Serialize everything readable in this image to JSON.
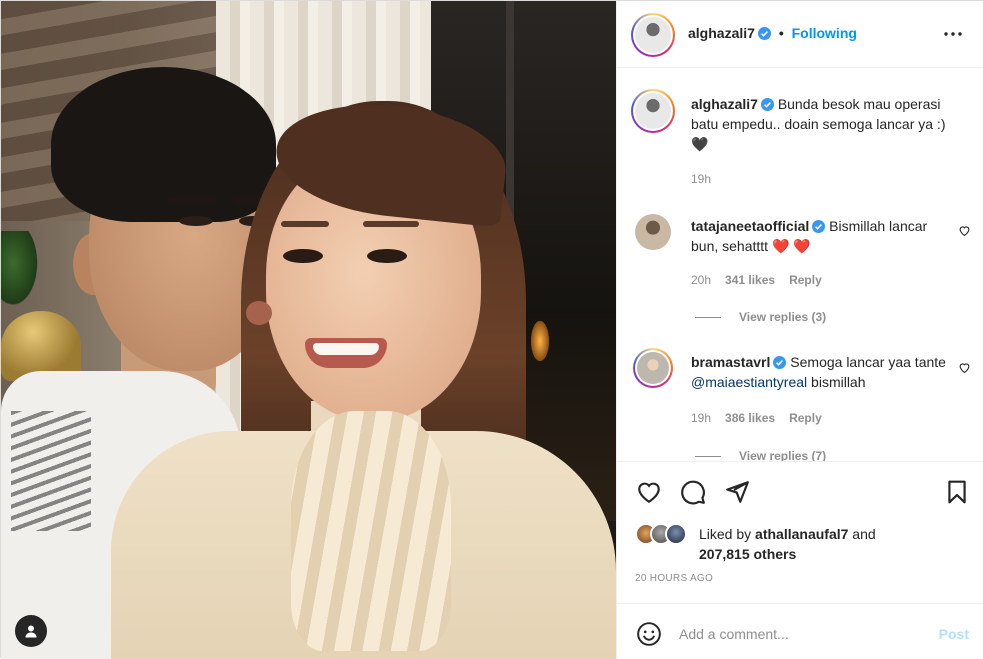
{
  "post": {
    "author": "alghazali7",
    "follow_status": "Following",
    "caption": {
      "text": "Bunda besok mau operasi batu empedu.. doain semoga lancar ya :) 🖤",
      "time": "19h"
    }
  },
  "comments": [
    {
      "username": "tatajaneetaofficial",
      "text": "Bismillah lancar bun, sehatttt ❤️ ❤️",
      "time": "20h",
      "likes": "341 likes",
      "reply": "Reply",
      "view_replies": "View replies (3)"
    },
    {
      "username": "bramastavrl",
      "text_before": "Semoga lancar yaa tante ",
      "mention": "@maiaestiantyreal",
      "text_after": " bismillah",
      "time": "19h",
      "likes": "386 likes",
      "reply": "Reply",
      "view_replies": "View replies (7)"
    }
  ],
  "likes": {
    "liked_by_prefix": "Liked by ",
    "liked_by_user": "athallanaufal7",
    "and_text": " and",
    "others": "207,815 others"
  },
  "timestamp": "20 HOURS AGO",
  "comment_box": {
    "placeholder": "Add a comment...",
    "post_label": "Post"
  },
  "icons": {
    "verified": "verified-badge-icon",
    "more": "more-options-icon",
    "like": "heart-icon",
    "comment": "comment-bubble-icon",
    "share": "paper-plane-icon",
    "save": "bookmark-icon",
    "emoji": "smiley-icon",
    "tag": "user-tag-icon"
  },
  "colors": {
    "link_blue": "#0095f6",
    "mention": "#00376b",
    "muted": "#8e8e8e",
    "text": "#262626",
    "post_disabled": "#b2dffc"
  }
}
